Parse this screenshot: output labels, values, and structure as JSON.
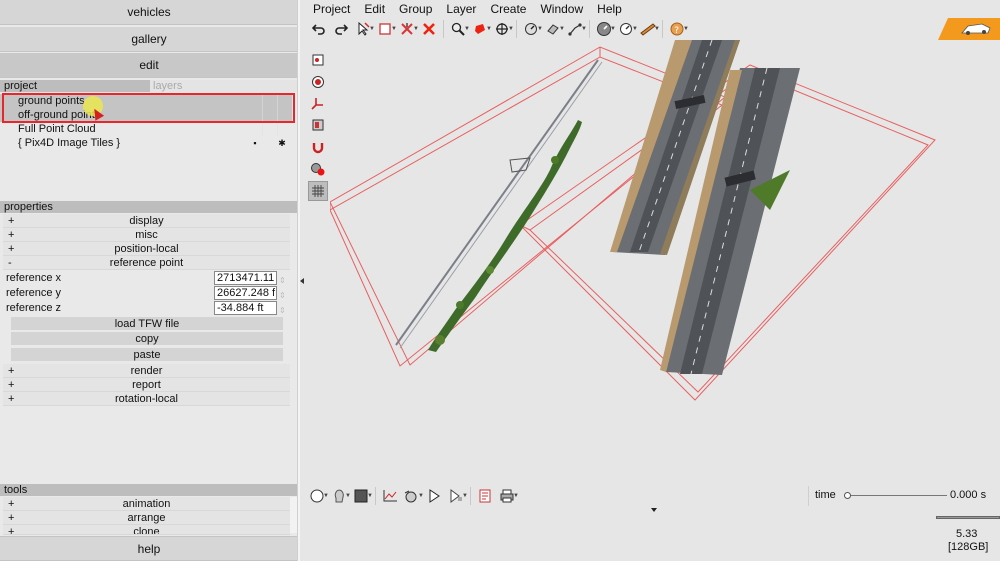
{
  "left_panel": {
    "buttons": {
      "vehicles": "vehicles",
      "gallery": "gallery",
      "edit": "edit",
      "help": "help"
    },
    "project_header": {
      "project_tab": "project",
      "layers_tab": "layers"
    },
    "project_items": [
      {
        "label": "ground points",
        "cell1": "",
        "cell2": ""
      },
      {
        "label": "off-ground points",
        "cell1": "",
        "cell2": ""
      },
      {
        "label": "Full Point Cloud",
        "cell1": "",
        "cell2": ""
      },
      {
        "label": "{ Pix4D Image Tiles }",
        "cell1": "▪",
        "cell2": "✱"
      }
    ],
    "properties": {
      "header": "properties",
      "sections_top": [
        {
          "sign": "+",
          "label": "display"
        },
        {
          "sign": "+",
          "label": "misc"
        },
        {
          "sign": "+",
          "label": "position-local"
        },
        {
          "sign": "-",
          "label": "reference point"
        }
      ],
      "reference": [
        {
          "label": "reference x",
          "value": "2713471.11"
        },
        {
          "label": "reference y",
          "value": "26627.248 f"
        },
        {
          "label": "reference z",
          "value": "-34.884 ft"
        }
      ],
      "actions": [
        "load TFW file",
        "copy",
        "paste"
      ],
      "sections_bottom": [
        {
          "sign": "+",
          "label": "render"
        },
        {
          "sign": "+",
          "label": "report"
        },
        {
          "sign": "+",
          "label": "rotation-local"
        }
      ]
    },
    "tools": {
      "header": "tools",
      "items": [
        {
          "sign": "+",
          "label": "animation"
        },
        {
          "sign": "+",
          "label": "arrange"
        },
        {
          "sign": "+",
          "label": "clone"
        }
      ]
    }
  },
  "menu": [
    "Project",
    "Edit",
    "Group",
    "Layer",
    "Create",
    "Window",
    "Help"
  ],
  "toolbar_icons": [
    "undo-icon",
    "redo-icon",
    "select-icon",
    "box-icon",
    "delete-icon",
    "close-icon",
    "zoom-icon",
    "shape-icon",
    "move-icon",
    "measure-icon",
    "paint-icon",
    "path-icon",
    "gauge-icon",
    "ruler-icon",
    "help-icon"
  ],
  "timeline": {
    "label": "time",
    "value": "0.000 s",
    "position": 0.0
  },
  "status": {
    "fps": "5.33",
    "memory": "[128GB]"
  },
  "colors": {
    "highlight": "#e8262c",
    "accent": "#f39a1e",
    "box_lines": "#e86060"
  }
}
